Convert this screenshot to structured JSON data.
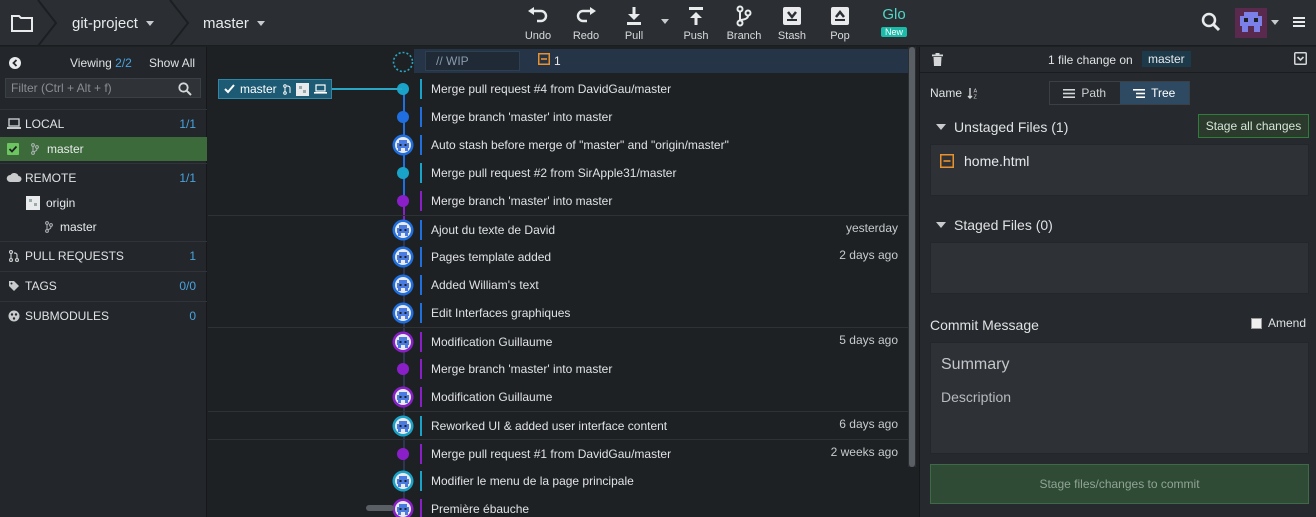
{
  "toolbar": {
    "repo": "git-project",
    "branch": "master",
    "buttons": [
      {
        "label": "Undo",
        "icon": "undo-icon"
      },
      {
        "label": "Redo",
        "icon": "redo-icon"
      },
      {
        "label": "Pull",
        "icon": "pull-icon"
      },
      {
        "label": "Push",
        "icon": "push-icon"
      },
      {
        "label": "Branch",
        "icon": "branch-icon"
      },
      {
        "label": "Stash",
        "icon": "stash-icon"
      },
      {
        "label": "Pop",
        "icon": "pop-icon"
      }
    ],
    "glo": {
      "label": "Glo",
      "badge": "New"
    }
  },
  "sidebar": {
    "viewing_label": "Viewing",
    "viewing_count": "2/2",
    "show_all": "Show All",
    "filter_placeholder": "Filter (Ctrl + Alt + f)",
    "sections": {
      "local": {
        "label": "LOCAL",
        "count": "1/1"
      },
      "remote": {
        "label": "REMOTE",
        "count": "1/1"
      },
      "pull_requests": {
        "label": "PULL REQUESTS",
        "count": "1"
      },
      "tags": {
        "label": "TAGS",
        "count": "0/0"
      },
      "submodules": {
        "label": "SUBMODULES",
        "count": "0"
      }
    },
    "local_branch": "master",
    "remote_name": "origin",
    "remote_branch": "master"
  },
  "graph": {
    "wip_placeholder": "// WIP",
    "wip_count": "1",
    "branch_tag": "master",
    "commits": [
      {
        "message": "Merge pull request #4 from DavidGau/master",
        "time": "",
        "node": "dot",
        "color": "#1aa3c9"
      },
      {
        "message": "Merge branch 'master' into master",
        "time": "",
        "node": "dot",
        "color": "#1f6fe0"
      },
      {
        "message": "Auto stash before merge of \"master\" and \"origin/master\"",
        "time": "",
        "node": "avatar",
        "color": "#1f6fe0"
      },
      {
        "message": "Merge pull request #2 from SirApple31/master",
        "time": "",
        "node": "dot",
        "color": "#1aa3c9"
      },
      {
        "message": "Merge branch 'master' into master",
        "time": "",
        "node": "dot",
        "color": "#8a1fc9"
      },
      {
        "message": "Ajout du texte de David",
        "time": "yesterday",
        "node": "avatar",
        "color": "#1f6fe0"
      },
      {
        "message": "Pages template added",
        "time": "2 days ago",
        "node": "avatar",
        "color": "#1f6fe0"
      },
      {
        "message": "Added William's text",
        "time": "",
        "node": "avatar",
        "color": "#1f6fe0"
      },
      {
        "message": "Edit Interfaces graphiques",
        "time": "",
        "node": "avatar",
        "color": "#1f6fe0"
      },
      {
        "message": "Modification Guillaume",
        "time": "5 days ago",
        "node": "avatar",
        "color": "#8a1fc9"
      },
      {
        "message": "Merge branch 'master' into master",
        "time": "",
        "node": "dot",
        "color": "#8a1fc9"
      },
      {
        "message": "Modification Guillaume",
        "time": "",
        "node": "avatar",
        "color": "#8a1fc9"
      },
      {
        "message": "Reworked UI & added user interface content",
        "time": "6 days ago",
        "node": "avatar",
        "color": "#1aa3c9"
      },
      {
        "message": "Merge pull request #1 from DavidGau/master",
        "time": "2 weeks ago",
        "node": "dot",
        "color": "#8a1fc9"
      },
      {
        "message": "Modifier le menu de la page principale",
        "time": "",
        "node": "avatar",
        "color": "#1aa3c9"
      },
      {
        "message": "Première ébauche",
        "time": "",
        "node": "avatar",
        "color": "#8a1fc9"
      }
    ]
  },
  "detail": {
    "header_text": "1 file change on",
    "header_branch": "master",
    "sort_label": "Name",
    "view_path": "Path",
    "view_tree": "Tree",
    "unstaged_title": "Unstaged Files (1)",
    "stage_all": "Stage all changes",
    "unstaged_file": "home.html",
    "staged_title": "Staged Files (0)",
    "commit_message_title": "Commit Message",
    "amend_label": "Amend",
    "summary_placeholder": "Summary",
    "description_placeholder": "Description",
    "commit_button": "Stage files/changes to commit"
  },
  "colors": {
    "accent": "#4aa3df",
    "stage_green": "#2e7d3a",
    "wip_orange": "#e8912d",
    "glo": "#4fd7c9"
  }
}
